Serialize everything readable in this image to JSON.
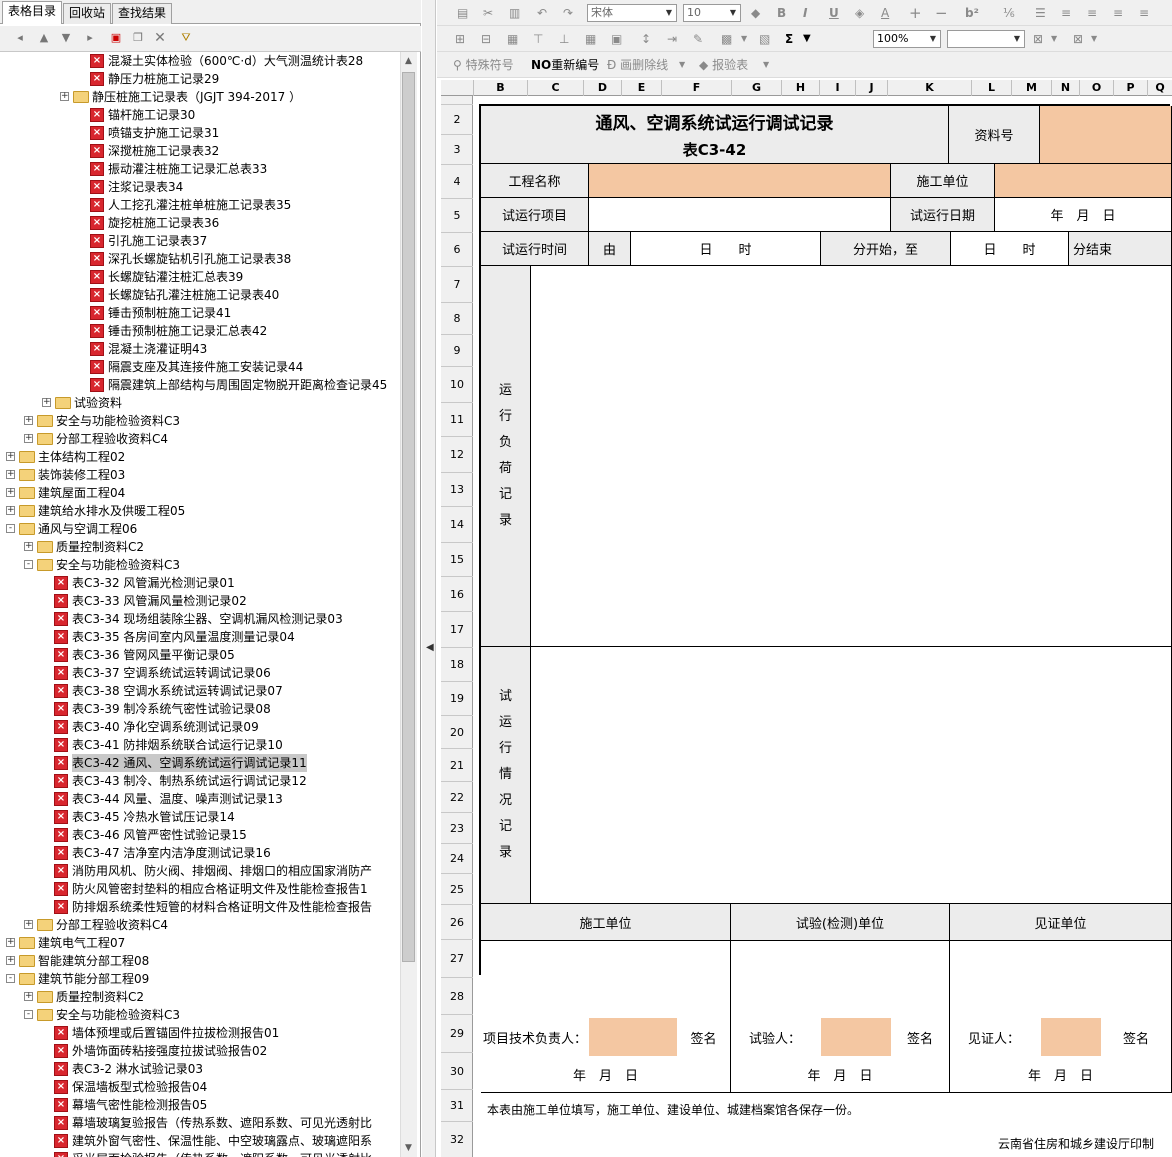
{
  "tabs": [
    "表格目录",
    "回收站",
    "查找结果"
  ],
  "tree": [
    {
      "level": 5,
      "type": "doc",
      "label": "混凝土实体检验（600℃·d）大气测温统计表28"
    },
    {
      "level": 5,
      "type": "doc",
      "label": "静压力桩施工记录29"
    },
    {
      "level": 4,
      "type": "folder",
      "expand": "+",
      "label": "静压桩施工记录表（JGJT 394-2017 ）"
    },
    {
      "level": 5,
      "type": "doc",
      "label": "锚杆施工记录30"
    },
    {
      "level": 5,
      "type": "doc",
      "label": "喷锚支护施工记录31"
    },
    {
      "level": 5,
      "type": "doc",
      "label": "深搅桩施工记录表32"
    },
    {
      "level": 5,
      "type": "doc",
      "label": "振动灌注桩施工记录汇总表33"
    },
    {
      "level": 5,
      "type": "doc",
      "label": "注浆记录表34"
    },
    {
      "level": 5,
      "type": "doc",
      "label": "人工挖孔灌注桩单桩施工记录表35"
    },
    {
      "level": 5,
      "type": "doc",
      "label": "旋挖桩施工记录表36"
    },
    {
      "level": 5,
      "type": "doc",
      "label": "引孔施工记录表37"
    },
    {
      "level": 5,
      "type": "doc",
      "label": "深孔长螺旋钻机引孔施工记录表38"
    },
    {
      "level": 5,
      "type": "doc",
      "label": "长螺旋钻灌注桩汇总表39"
    },
    {
      "level": 5,
      "type": "doc",
      "label": "长螺旋钻孔灌注桩施工记录表40"
    },
    {
      "level": 5,
      "type": "doc",
      "label": "锤击预制桩施工记录41"
    },
    {
      "level": 5,
      "type": "doc",
      "label": "锤击预制桩施工记录汇总表42"
    },
    {
      "level": 5,
      "type": "doc",
      "label": "混凝土浇灌证明43"
    },
    {
      "level": 5,
      "type": "doc",
      "label": "隔震支座及其连接件施工安装记录44"
    },
    {
      "level": 5,
      "type": "doc",
      "label": "隔震建筑上部结构与周围固定物脱开距离检查记录45"
    },
    {
      "level": 3,
      "type": "folder",
      "expand": "+",
      "label": "试验资料"
    },
    {
      "level": 2,
      "type": "folder",
      "expand": "+",
      "label": "安全与功能检验资料C3"
    },
    {
      "level": 2,
      "type": "folder",
      "expand": "+",
      "label": "分部工程验收资料C4"
    },
    {
      "level": 1,
      "type": "folder",
      "expand": "+",
      "label": "主体结构工程02"
    },
    {
      "level": 1,
      "type": "folder",
      "expand": "+",
      "label": "装饰装修工程03"
    },
    {
      "level": 1,
      "type": "folder",
      "expand": "+",
      "label": "建筑屋面工程04"
    },
    {
      "level": 1,
      "type": "folder",
      "expand": "+",
      "label": "建筑给水排水及供暖工程05"
    },
    {
      "level": 1,
      "type": "folder",
      "expand": "-",
      "label": "通风与空调工程06"
    },
    {
      "level": 2,
      "type": "folder",
      "expand": "+",
      "label": "质量控制资料C2"
    },
    {
      "level": 2,
      "type": "folder",
      "expand": "-",
      "label": "安全与功能检验资料C3"
    },
    {
      "level": 3,
      "type": "doc",
      "label": "表C3-32 风管漏光检测记录01"
    },
    {
      "level": 3,
      "type": "doc",
      "label": "表C3-33 风管漏风量检测记录02"
    },
    {
      "level": 3,
      "type": "doc",
      "label": "表C3-34 现场组装除尘器、空调机漏风检测记录03"
    },
    {
      "level": 3,
      "type": "doc",
      "label": "表C3-35 各房间室内风量温度测量记录04"
    },
    {
      "level": 3,
      "type": "doc",
      "label": "表C3-36 管网风量平衡记录05"
    },
    {
      "level": 3,
      "type": "doc",
      "label": "表C3-37 空调系统试运转调试记录06"
    },
    {
      "level": 3,
      "type": "doc",
      "label": "表C3-38 空调水系统试运转调试记录07"
    },
    {
      "level": 3,
      "type": "doc",
      "label": "表C3-39 制冷系统气密性试验记录08"
    },
    {
      "level": 3,
      "type": "doc",
      "label": "表C3-40 净化空调系统测试记录09"
    },
    {
      "level": 3,
      "type": "doc",
      "label": "表C3-41 防排烟系统联合试运行记录10"
    },
    {
      "level": 3,
      "type": "doc",
      "selected": true,
      "label": "表C3-42 通风、空调系统试运行调试记录11"
    },
    {
      "level": 3,
      "type": "doc",
      "label": "表C3-43 制冷、制热系统试运行调试记录12"
    },
    {
      "level": 3,
      "type": "doc",
      "label": "表C3-44 风量、温度、噪声测试记录13"
    },
    {
      "level": 3,
      "type": "doc",
      "label": "表C3-45 冷热水管试压记录14"
    },
    {
      "level": 3,
      "type": "doc",
      "label": "表C3-46 风管严密性试验记录15"
    },
    {
      "level": 3,
      "type": "doc",
      "label": "表C3-47 洁净室内洁净度测试记录16"
    },
    {
      "level": 3,
      "type": "doc",
      "label": "消防用风机、防火阀、排烟阀、排烟口的相应国家消防产"
    },
    {
      "level": 3,
      "type": "doc",
      "label": "防火风管密封垫料的相应合格证明文件及性能检查报告1"
    },
    {
      "level": 3,
      "type": "doc",
      "label": "防排烟系统柔性短管的材料合格证明文件及性能检查报告"
    },
    {
      "level": 2,
      "type": "folder",
      "expand": "+",
      "label": "分部工程验收资料C4"
    },
    {
      "level": 1,
      "type": "folder",
      "expand": "+",
      "label": "建筑电气工程07"
    },
    {
      "level": 1,
      "type": "folder",
      "expand": "+",
      "label": "智能建筑分部工程08"
    },
    {
      "level": 1,
      "type": "folder",
      "expand": "-",
      "label": "建筑节能分部工程09"
    },
    {
      "level": 2,
      "type": "folder",
      "expand": "+",
      "label": "质量控制资料C2"
    },
    {
      "level": 2,
      "type": "folder",
      "expand": "-",
      "label": "安全与功能检验资料C3"
    },
    {
      "level": 3,
      "type": "doc",
      "label": "墙体预埋或后置锚固件拉拔检测报告01"
    },
    {
      "level": 3,
      "type": "doc",
      "label": "外墙饰面砖粘接强度拉拔试验报告02"
    },
    {
      "level": 3,
      "type": "doc",
      "label": "表C3-2 淋水试验记录03"
    },
    {
      "level": 3,
      "type": "doc",
      "label": "保温墙板型式检验报告04"
    },
    {
      "level": 3,
      "type": "doc",
      "label": "幕墙气密性能检测报告05"
    },
    {
      "level": 3,
      "type": "doc",
      "label": "幕墙玻璃复验报告（传热系数、遮阳系数、可见光透射比"
    },
    {
      "level": 3,
      "type": "doc",
      "label": "建筑外窗气密性、保温性能、中空玻璃露点、玻璃遮阳系"
    },
    {
      "level": 3,
      "type": "doc",
      "label": "采光屋面检验报告（传热系数、遮阳系数、可见光透射比"
    }
  ],
  "toolbar": {
    "font_name": "宋体",
    "font_size": "10",
    "zoom": "100%",
    "special_symbol": "特殊符号",
    "renumber": "重新编号",
    "draw_delete_line": "画删除线",
    "report_table": "报验表",
    "no_icon_text": "NO",
    "bold": "B",
    "italic": "I",
    "underline": "U",
    "superscript": "b²",
    "sigma": "Σ"
  },
  "sheet": {
    "columns": [
      "B",
      "C",
      "D",
      "E",
      "F",
      "G",
      "H",
      "I",
      "J",
      "K",
      "L",
      "M",
      "N",
      "O",
      "P",
      "Q"
    ],
    "rows": [
      "2",
      "3",
      "4",
      "5",
      "6",
      "7",
      "8",
      "9",
      "10",
      "11",
      "12",
      "13",
      "14",
      "15",
      "16",
      "17",
      "18",
      "19",
      "20",
      "21",
      "22",
      "23",
      "24",
      "25",
      "26",
      "27",
      "28",
      "29",
      "30",
      "31",
      "32"
    ]
  },
  "form": {
    "title": "通风、空调系统试运行调试记录",
    "code": "表C3-42",
    "doc_no_label": "资料号",
    "project_name_label": "工程名称",
    "construction_unit_label": "施工单位",
    "trial_item_label": "试运行项目",
    "trial_date_label": "试运行日期",
    "date_ymd": "年　月　日",
    "trial_time_label": "试运行时间",
    "from": "由",
    "day_hour": "日　　时",
    "min_start_to": "分开始，至",
    "day_hour2": "日　　时",
    "min_end": "分结束",
    "load_record_chars": [
      "运",
      "行",
      "负",
      "荷",
      "记",
      "录"
    ],
    "run_record_chars": [
      "试",
      "运",
      "行",
      "情",
      "况",
      "记",
      "录"
    ],
    "sig_construction": "施工单位",
    "sig_test": "试验(检测)单位",
    "sig_witness": "见证单位",
    "tech_lead": "项目技术负责人：",
    "tester": "试验人：",
    "witness": "见证人：",
    "sign": "签名",
    "footer_note": "本表由施工单位填写，施工单位、建设单位、城建档案馆各保存一份。",
    "printer": "云南省住房和城乡建设厅印制"
  },
  "colors": {
    "highlight": "#f4c7a2",
    "selected": "#c8c8c8",
    "doc_icon": "#d8262e",
    "folder": "#f4d27a"
  }
}
